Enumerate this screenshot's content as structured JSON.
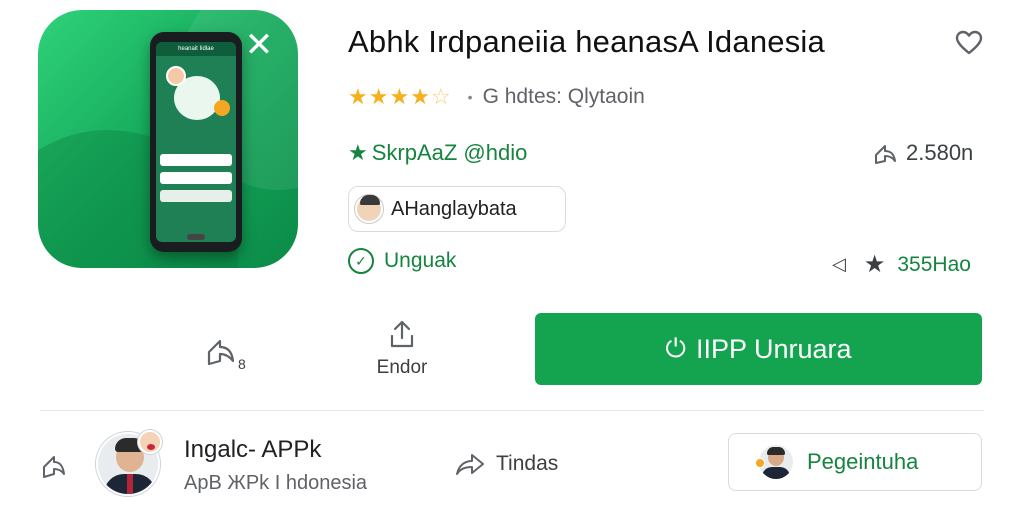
{
  "app": {
    "title": "Abhk Irdpaneiia heanasA Idanesia",
    "rating": {
      "stars": 4,
      "max_stars": 5,
      "text": "G hdtes: Qlytaoin"
    },
    "developer": "SkrpAaZ @hdio",
    "share_count": "2.580n",
    "chip_label": "AHanglaybata",
    "status": "Unguak",
    "reviews_count": "355Hao",
    "icon_screen_title": "heanait Iidlae"
  },
  "actions": {
    "share_number": "8",
    "send_label": "Endor",
    "install_label": "IIPP Unruara"
  },
  "publisher": {
    "name": "Ingalc- APPk",
    "subtitle": "ApB ЖPk I hdonesia",
    "tindas_label": "Tindas",
    "follow_label": "Pegeintuha"
  },
  "colors": {
    "accent_green": "#14a450",
    "text_green": "#16843f",
    "star": "#f6b01e"
  },
  "icons": [
    "close-icon",
    "heart-icon",
    "star-icon",
    "share-icon",
    "upload-icon",
    "check-circle-icon",
    "back-triangle-icon",
    "forward-share-icon"
  ]
}
